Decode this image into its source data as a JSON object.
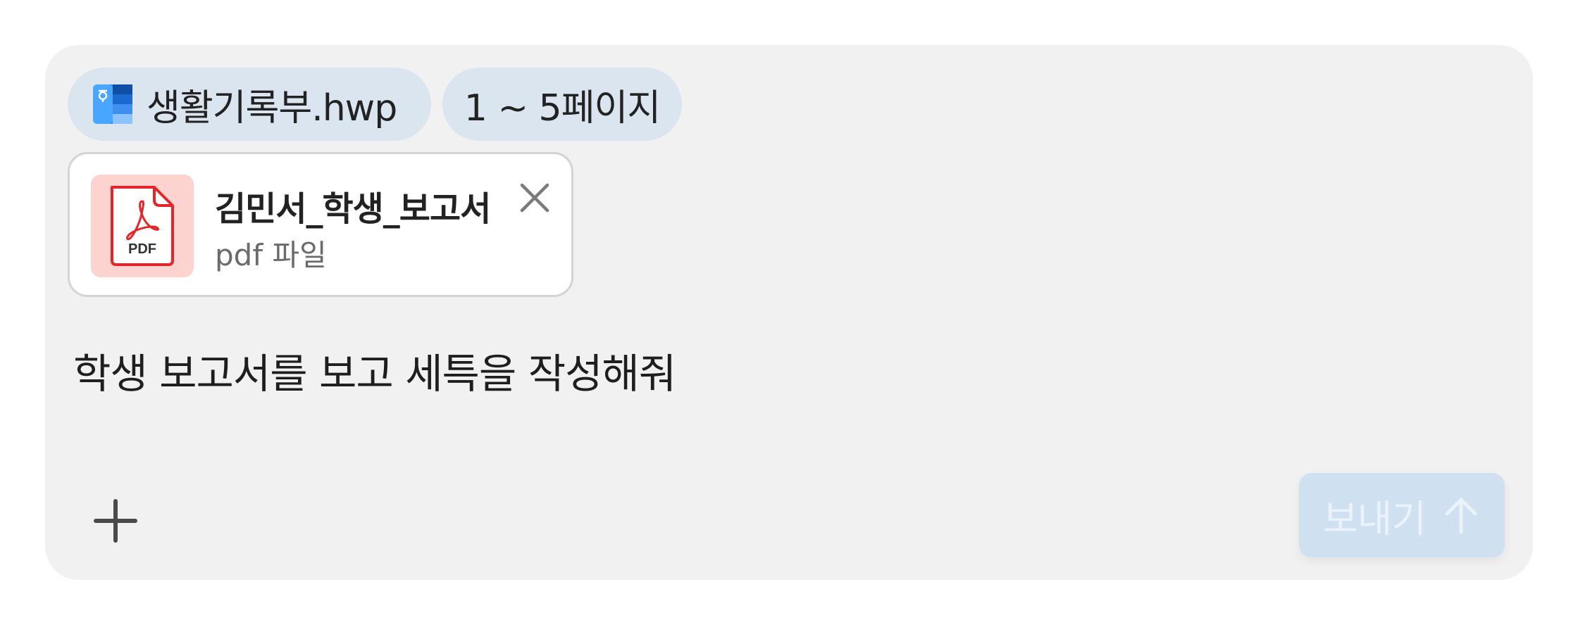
{
  "context_chips": {
    "file": {
      "label": "생활기록부.hwp",
      "icon": "hwp-document-icon"
    },
    "page_range": {
      "label": "1 ~ 5페이지"
    }
  },
  "attachment": {
    "name": "김민서_학생_보고서",
    "type_label": "pdf 파일",
    "icon": "pdf-file-icon",
    "icon_text": "PDF"
  },
  "prompt": {
    "text": "학생 보고서를 보고 세특을 작성해줘"
  },
  "toolbar": {
    "add_icon": "plus-icon",
    "send_label": "보내기",
    "send_icon": "arrow-up-icon"
  },
  "colors": {
    "composer_bg": "#f1f1f1",
    "chip_bg": "#dbe5ef",
    "pdf_accent": "#e3262a",
    "send_bg_disabled": "#cfe0f0"
  }
}
